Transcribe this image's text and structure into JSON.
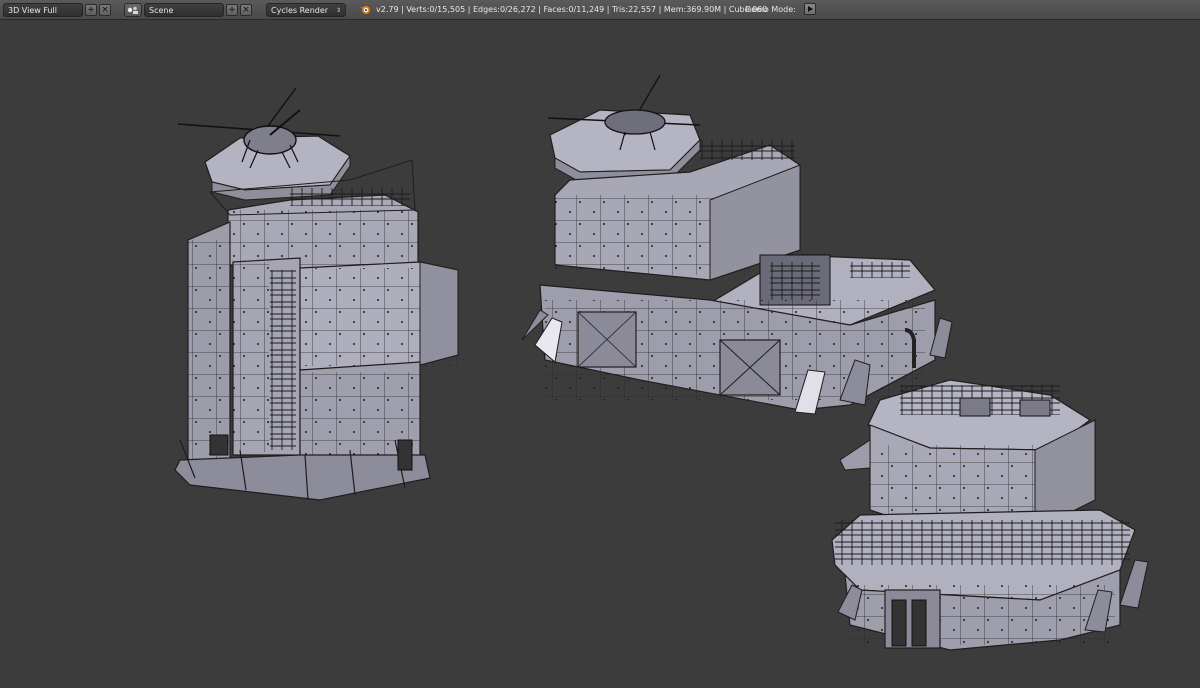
{
  "header": {
    "screen_layout": {
      "value": "3D View Full",
      "icon": "screen-layout-icon"
    },
    "scene": {
      "value": "Scene",
      "icon": "scene-icon"
    },
    "render_engine": {
      "value": "Cycles Render",
      "icon": "updown-arrows-icon"
    },
    "blender_logo_icon": "blender-logo-icon",
    "stats": "v2.79 | Verts:0/15,505 | Edges:0/26,272 | Faces:0/11,249 | Tris:22,557 | Mem:369.90M | Cube.060",
    "demo_mode_label": "Demo Mode:",
    "play_icon": "play-icon",
    "add_icon": "plus-icon",
    "close_icon": "x-icon"
  },
  "colors": {
    "header_bg": "#4d4d4d",
    "viewport_bg": "#3c3c3c",
    "mesh_face": "#a9a9b8",
    "mesh_wire": "#1e1e1e",
    "accent_orange": "#e87d0d"
  }
}
